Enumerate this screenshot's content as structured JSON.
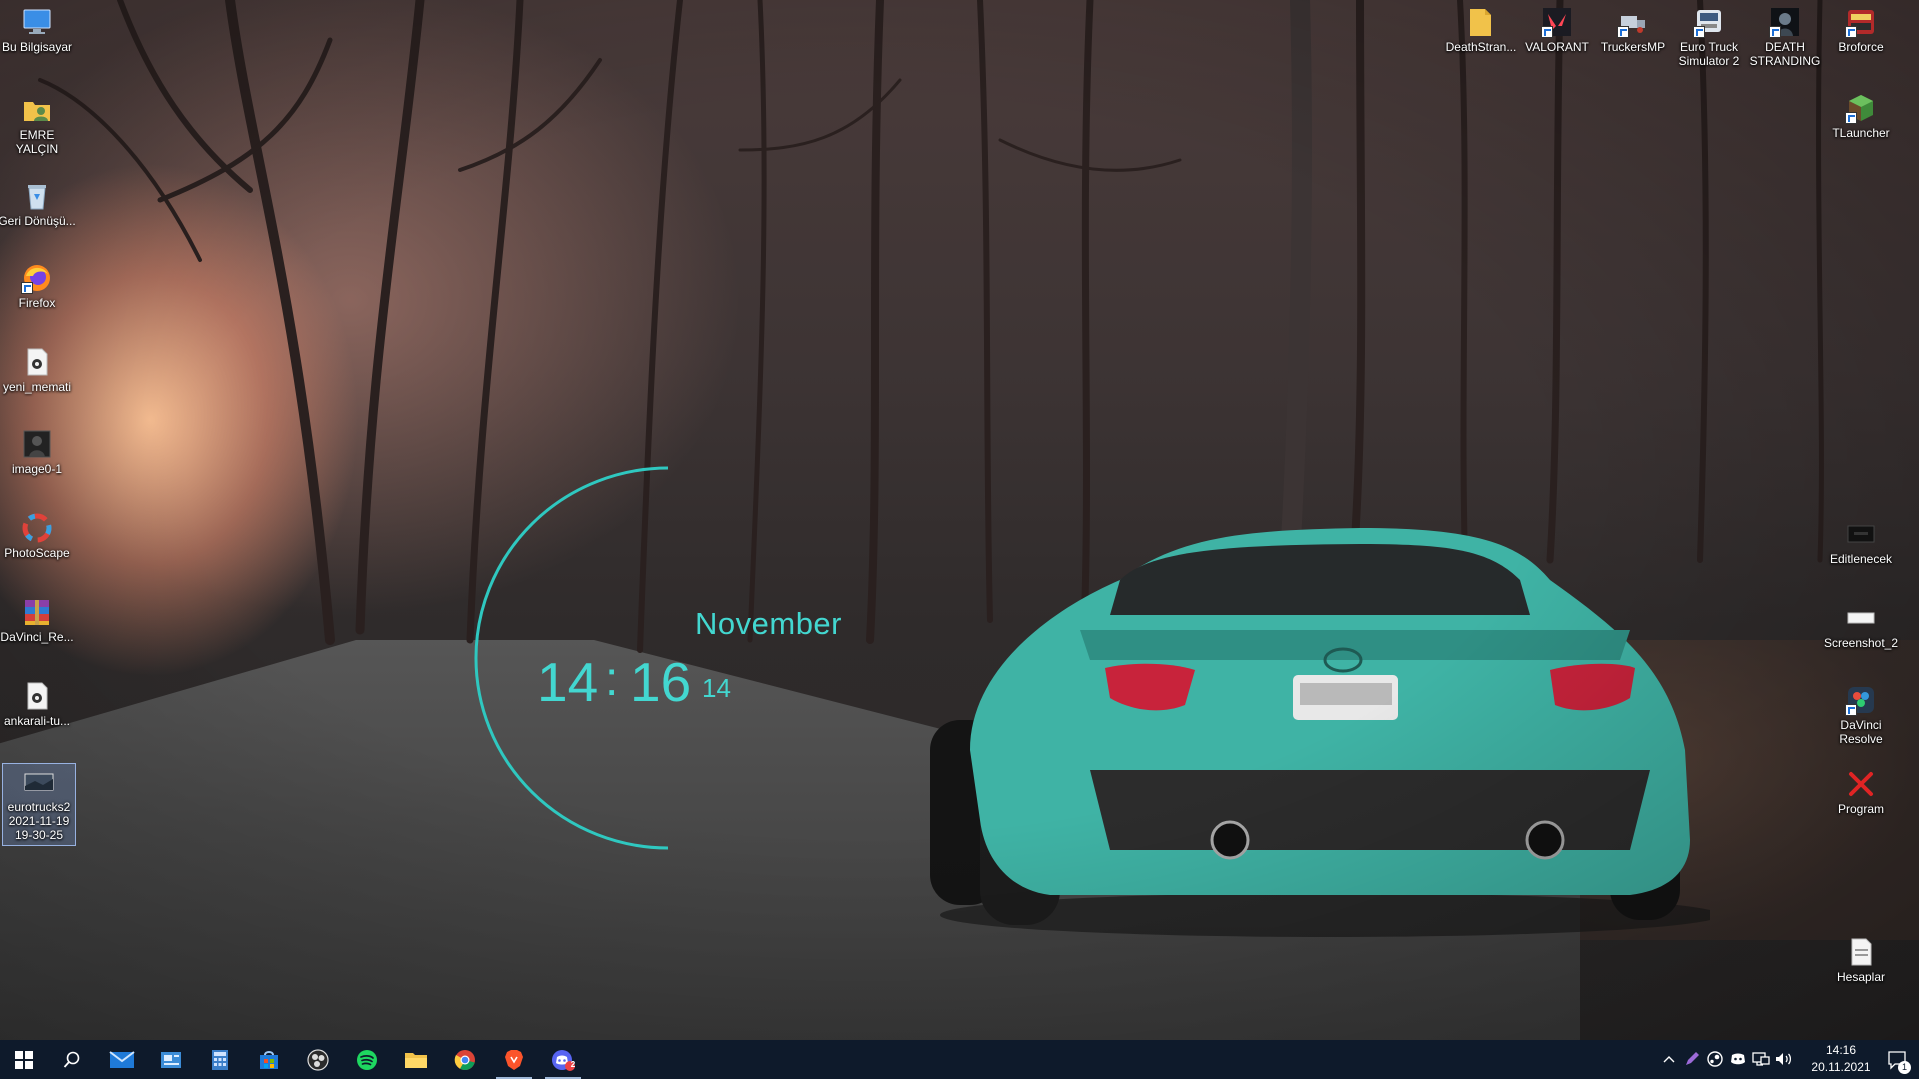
{
  "desktop": {
    "left_icons": [
      {
        "label": "Bu Bilgisayar",
        "icon": "this-pc-icon"
      },
      {
        "label": "EMRE YALÇIN",
        "icon": "user-folder-icon"
      },
      {
        "label": "Geri Dönüşü...",
        "icon": "recycle-bin-icon"
      },
      {
        "label": "Firefox",
        "icon": "firefox-icon"
      },
      {
        "label": "yeni_memati",
        "icon": "media-file-icon"
      },
      {
        "label": "image0-1",
        "icon": "image-file-icon"
      },
      {
        "label": "PhotoScape",
        "icon": "photoscape-icon"
      },
      {
        "label": "DaVinci_Re...",
        "icon": "winrar-archive-icon"
      },
      {
        "label": "ankarali-tu...",
        "icon": "media-file-icon"
      },
      {
        "label": "eurotrucks2 2021-11-19 19-30-25",
        "icon": "screenshot-file-icon"
      }
    ],
    "top_right_icons": [
      {
        "label": "DeathStran...",
        "icon": "folder-icon"
      },
      {
        "label": "VALORANT",
        "icon": "valorant-icon"
      },
      {
        "label": "TruckersMP",
        "icon": "truckersmp-icon"
      },
      {
        "label": "Euro Truck Simulator 2",
        "icon": "euro-truck-simulator-icon"
      },
      {
        "label": "DEATH STRANDING",
        "icon": "death-stranding-icon"
      },
      {
        "label": "Broforce",
        "icon": "broforce-icon"
      }
    ],
    "right_icons": [
      {
        "label": "TLauncher",
        "icon": "tlauncher-icon"
      },
      {
        "label": "Editlenecek",
        "icon": "video-file-icon"
      },
      {
        "label": "Screenshot_2",
        "icon": "image-file-icon"
      },
      {
        "label": "DaVinci Resolve",
        "icon": "davinci-resolve-icon"
      },
      {
        "label": "Program",
        "icon": "red-x-icon"
      },
      {
        "label": "Hesaplar",
        "icon": "docx-file-icon"
      }
    ]
  },
  "clock_widget": {
    "month": "November",
    "hour": "14",
    "separator": ":",
    "minute": "16",
    "second": "14",
    "accent_color": "#43d7d0"
  },
  "taskbar": {
    "pinned": [
      {
        "name": "start-button",
        "icon": "windows-logo-icon"
      },
      {
        "name": "search-button",
        "icon": "search-icon"
      },
      {
        "name": "mail-app",
        "icon": "mail-icon"
      },
      {
        "name": "news-app",
        "icon": "news-icon"
      },
      {
        "name": "calculator-app",
        "icon": "calculator-icon"
      },
      {
        "name": "store-app",
        "icon": "store-icon"
      },
      {
        "name": "obs-app",
        "icon": "obs-icon"
      },
      {
        "name": "spotify-app",
        "icon": "spotify-icon"
      },
      {
        "name": "file-explorer-app",
        "icon": "folder-icon"
      },
      {
        "name": "chrome-app",
        "icon": "chrome-icon"
      },
      {
        "name": "brave-app",
        "icon": "brave-icon"
      },
      {
        "name": "discord-app",
        "icon": "discord-icon"
      }
    ],
    "tray": [
      "chevron-up-icon",
      "pen-icon",
      "steam-icon",
      "discord-tray-icon",
      "network-icon",
      "volume-icon"
    ],
    "time": "14:16",
    "date": "20.11.2021",
    "notification_count": "1",
    "discord_badge": "2"
  }
}
